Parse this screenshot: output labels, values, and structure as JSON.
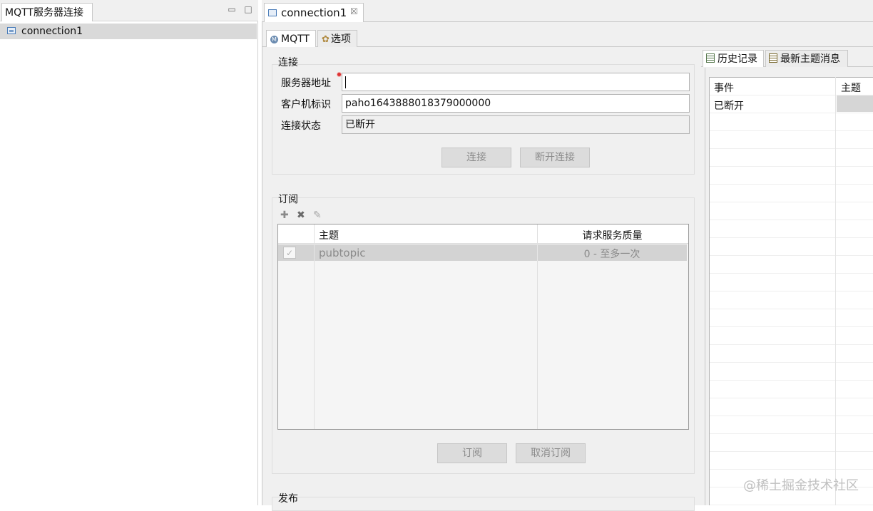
{
  "left_panel": {
    "tab_title": "MQTT服务器连接",
    "controls": {
      "minimize": "▭",
      "maximize": "□"
    },
    "tree_items": [
      {
        "label": "connection1",
        "icon": "connection-icon"
      }
    ]
  },
  "editor": {
    "tab_title": "connection1",
    "close_glyph": "☒",
    "inner_tabs": [
      {
        "label": "MQTT",
        "icon": "mqtt-icon",
        "glyph": "M"
      },
      {
        "label": "选项",
        "icon": "gear-icon",
        "glyph": "✿"
      }
    ]
  },
  "connection": {
    "title": "连接",
    "server_label": "服务器地址",
    "server_value": "",
    "client_id_label": "客户机标识",
    "client_id_value": "paho1643888018379000000",
    "status_label": "连接状态",
    "status_value": "已断开",
    "connect_button": "连接",
    "disconnect_button": "断开连接"
  },
  "subscription": {
    "title": "订阅",
    "toolbar": {
      "add": "✚",
      "delete": "✖",
      "edit": "✎"
    },
    "columns": [
      "",
      "主题",
      "请求服务质量"
    ],
    "rows": [
      {
        "checked": true,
        "check_glyph": "✓",
        "topic": "pubtopic",
        "qos": "0 - 至多一次"
      }
    ],
    "subscribe_button": "订阅",
    "unsubscribe_button": "取消订阅"
  },
  "publish": {
    "title": "发布"
  },
  "right_panel": {
    "tabs": [
      {
        "label": "历史记录",
        "icon": "history-list-icon"
      },
      {
        "label": "最新主题消息",
        "icon": "latest-messages-icon"
      }
    ],
    "columns": [
      "事件",
      "主题"
    ],
    "rows": [
      {
        "event": "已断开",
        "topic": ""
      }
    ]
  },
  "watermark": "@稀土掘金技术社区",
  "colors": {
    "selection": "#d9d9d9",
    "panel_bg": "#f0f0f0",
    "icon_blue": "#4a7cb8",
    "error_red": "#d33"
  }
}
